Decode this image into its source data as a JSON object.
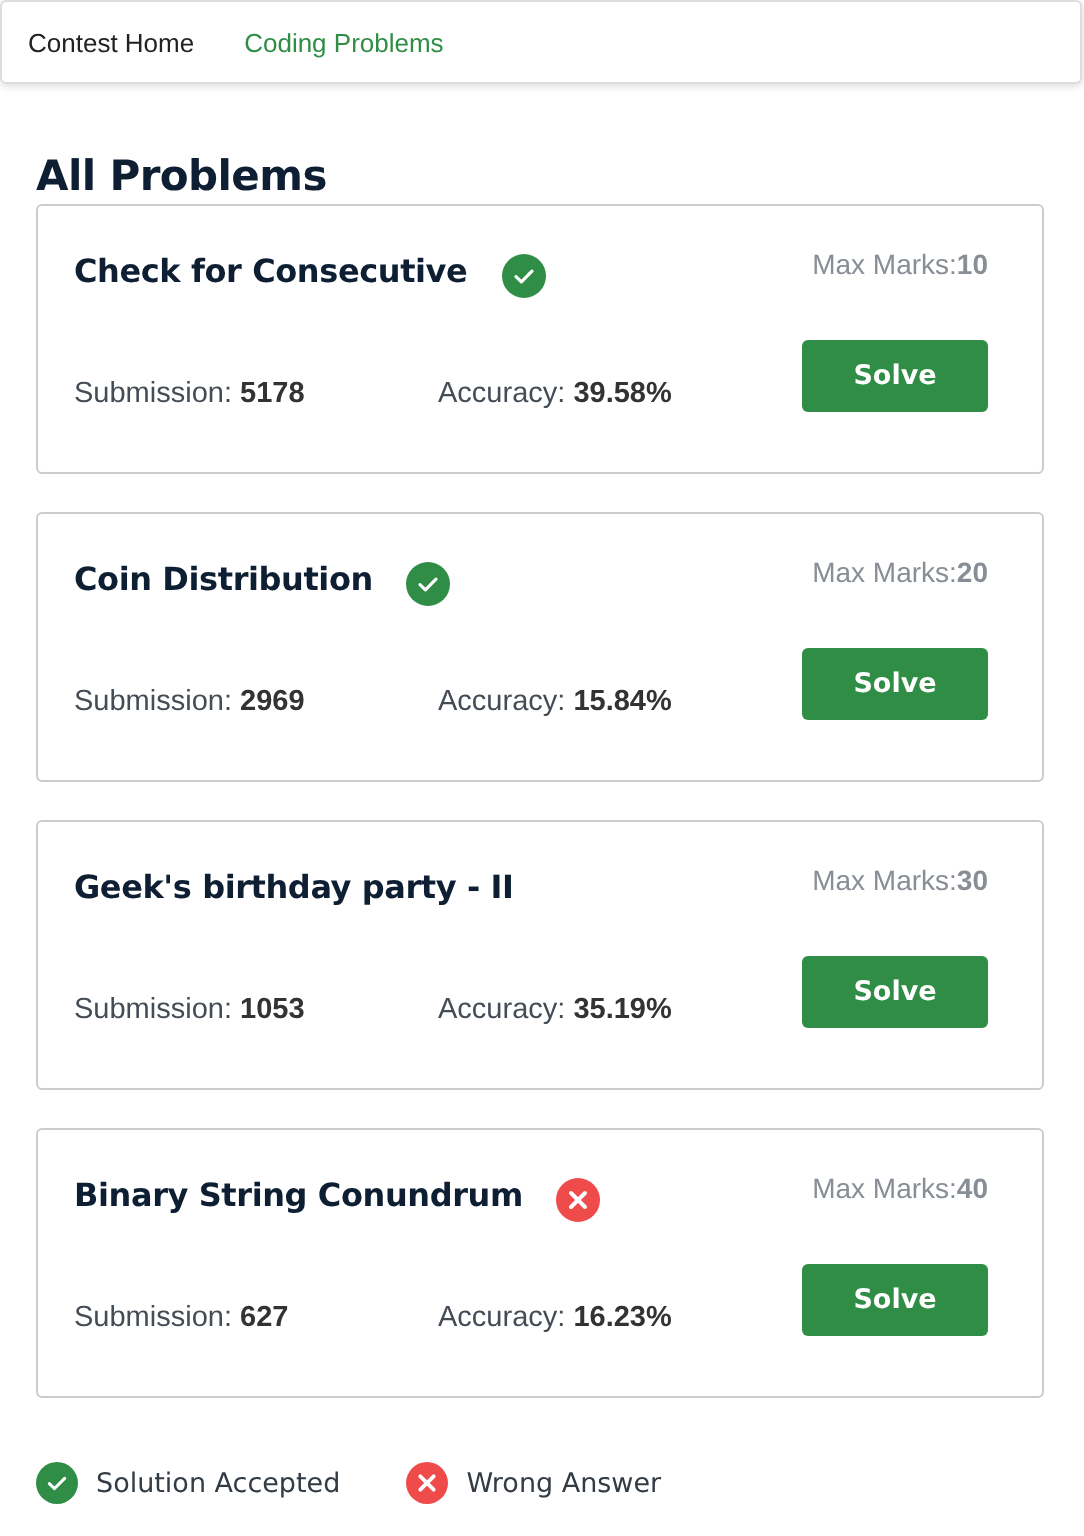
{
  "nav": {
    "tabs": [
      {
        "label": "Contest Home",
        "selected": false
      },
      {
        "label": "Coding Problems",
        "selected": true
      }
    ]
  },
  "heading": "All Problems",
  "problems": [
    {
      "title": "Check for Consecutive",
      "kind": "accepted",
      "marks_label": "Max Marks:",
      "marks": "10",
      "submission_label": "Submission:",
      "submissions": "5178",
      "accuracy_label": "Accuracy:",
      "accuracy": "39.58%",
      "button": "Solve"
    },
    {
      "title": "Coin Distribution",
      "kind": "accepted",
      "marks_label": "Max Marks:",
      "marks": "20",
      "submission_label": "Submission:",
      "submissions": "2969",
      "accuracy_label": "Accuracy:",
      "accuracy": "15.84%",
      "button": "Solve"
    },
    {
      "title": "Geek's birthday party - II",
      "kind": "plain",
      "marks_label": "Max Marks:",
      "marks": "30",
      "submission_label": "Submission:",
      "submissions": "1053",
      "accuracy_label": "Accuracy:",
      "accuracy": "35.19%",
      "button": "Solve"
    },
    {
      "title": "Binary String Conundrum",
      "kind": "wrong",
      "marks_label": "Max Marks:",
      "marks": "40",
      "submission_label": "Submission:",
      "submissions": "627",
      "accuracy_label": "Accuracy:",
      "accuracy": "16.23%",
      "button": "Solve"
    }
  ],
  "legend": [
    {
      "kind": "accepted",
      "label": "Solution Accepted"
    },
    {
      "kind": "wrong",
      "label": "Wrong Answer"
    }
  ]
}
